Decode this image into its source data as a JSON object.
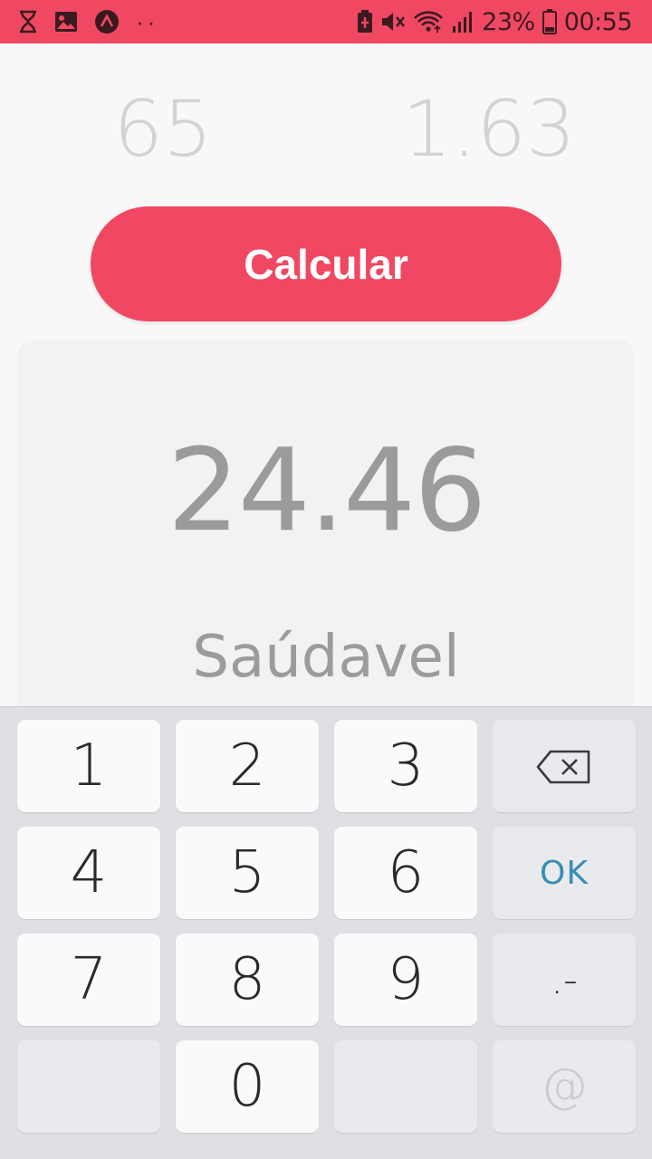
{
  "status_bar": {
    "left_icons": [
      "hourglass-icon",
      "image-icon",
      "app-logo-icon",
      "more-dots-icon"
    ],
    "dots": "··",
    "right_icons": [
      "battery-saver-icon",
      "mute-icon",
      "wifi-icon",
      "signal-icon",
      "battery-icon"
    ],
    "battery_percent": "23%",
    "time": "00:55"
  },
  "inputs": {
    "weight_placeholder": "65",
    "height_placeholder": "1.63"
  },
  "button": {
    "label": "Calcular"
  },
  "result": {
    "value": "24.46",
    "classification": "Saúdavel"
  },
  "keyboard": {
    "rows": [
      [
        "1",
        "2",
        "3",
        "backspace"
      ],
      [
        "4",
        "5",
        "6",
        "OK"
      ],
      [
        "7",
        "8",
        "9",
        ".-"
      ],
      [
        "",
        "0",
        "",
        "@"
      ]
    ],
    "ok_label": "OK",
    "punct_label": ".-",
    "at_label": "@"
  },
  "colors": {
    "accent": "#f04863",
    "placeholder_text": "#d3d3d3",
    "result_text": "#9b9b9b",
    "ok_text": "#3a8db5"
  }
}
